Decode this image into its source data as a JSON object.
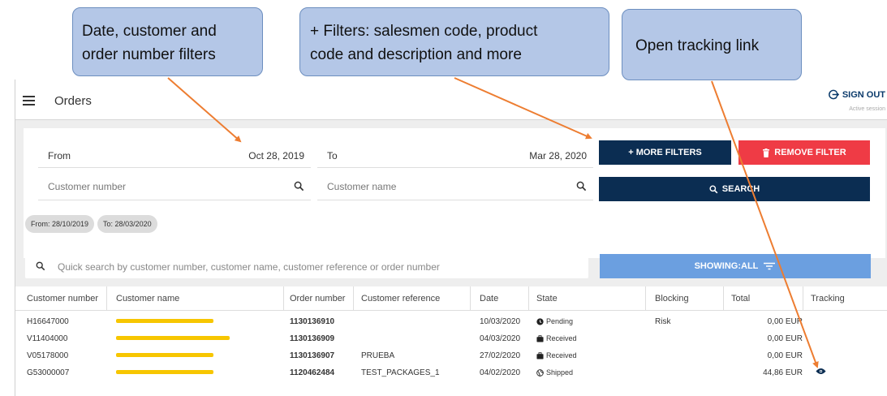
{
  "header": {
    "title": "Orders",
    "sign_out": "SIGN OUT",
    "session": "Active session"
  },
  "filters": {
    "from_label": "From",
    "from_value": "Oct 28, 2019",
    "to_label": "To",
    "to_value": "Mar 28, 2020",
    "customer_number_placeholder": "Customer number",
    "customer_name_placeholder": "Customer name",
    "more_filters": "+ MORE FILTERS",
    "remove_filter": "REMOVE FILTER",
    "search": "SEARCH",
    "chips": [
      "From: 28/10/2019",
      "To: 28/03/2020"
    ]
  },
  "quick_search": {
    "placeholder": "Quick search by customer number, customer name, customer reference or order number",
    "showing": "SHOWING:ALL"
  },
  "table": {
    "columns": [
      "Customer number",
      "Customer name",
      "Order number",
      "Customer reference",
      "Date",
      "State",
      "Blocking",
      "Total",
      "Tracking"
    ],
    "rows": [
      {
        "customer_number": "H16647000",
        "order_number": "1130136910",
        "reference": "",
        "date": "10/03/2020",
        "state": "Pending",
        "state_icon": "clock-icon",
        "blocking": "Risk",
        "total": "0,00 EUR",
        "tracking": false
      },
      {
        "customer_number": "V11404000",
        "order_number": "1130136909",
        "reference": "",
        "date": "04/03/2020",
        "state": "Received",
        "state_icon": "briefcase-icon",
        "blocking": "",
        "total": "0,00 EUR",
        "tracking": false
      },
      {
        "customer_number": "V05178000",
        "order_number": "1130136907",
        "reference": "PRUEBA",
        "date": "27/02/2020",
        "state": "Received",
        "state_icon": "briefcase-icon",
        "blocking": "",
        "total": "0,00 EUR",
        "tracking": false
      },
      {
        "customer_number": "G53000007",
        "order_number": "1120462484",
        "reference": "TEST_PACKAGES_1",
        "date": "04/02/2020",
        "state": "Shipped",
        "state_icon": "globe-icon",
        "blocking": "",
        "total": "44,86 EUR",
        "tracking": true
      }
    ]
  },
  "callouts": {
    "filters": [
      "Date, customer and",
      "order number filters"
    ],
    "more_filters": [
      "+ Filters: salesmen code, product",
      "code and description and more"
    ],
    "tracking": [
      "Open tracking link"
    ]
  },
  "colors": {
    "primary": "#0b2d52",
    "danger": "#ef3b45",
    "accent": "#6b9fe0",
    "callout_fill": "#b4c7e7",
    "arrow": "#ed7d31",
    "redaction": "#f7c600"
  }
}
